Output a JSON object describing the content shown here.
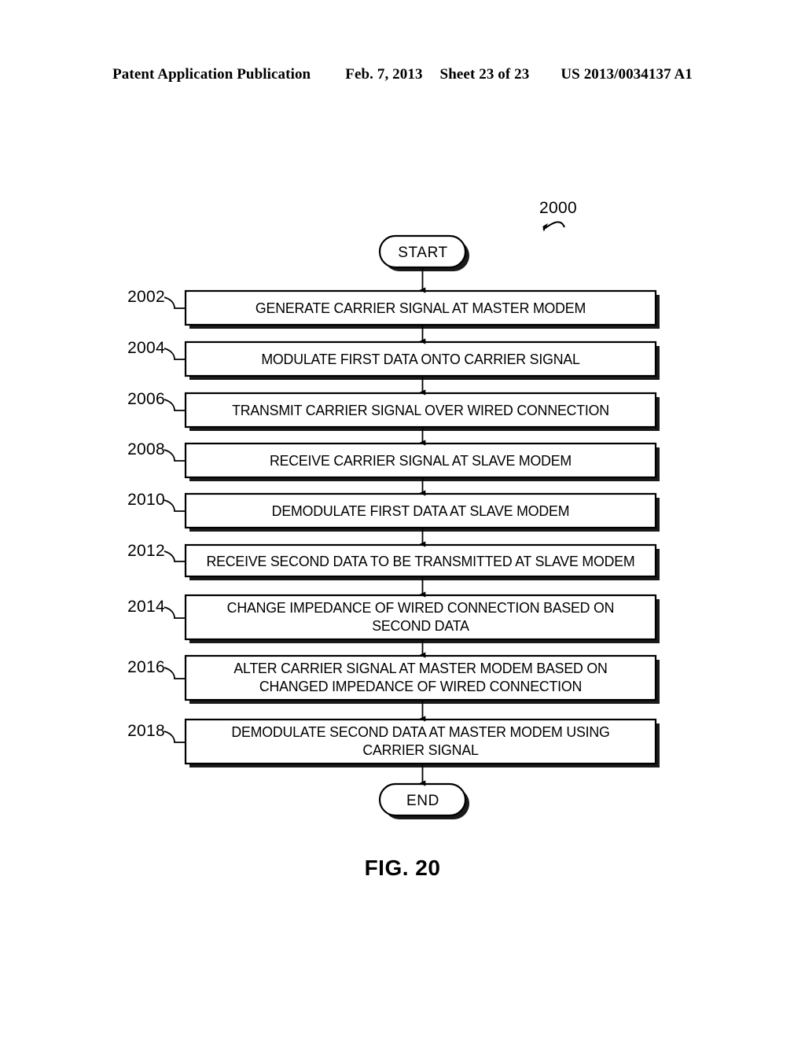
{
  "header": {
    "publication": "Patent Application Publication",
    "date": "Feb. 7, 2013",
    "sheet": "Sheet 23 of 23",
    "patent_number": "US 2013/0034137 A1"
  },
  "figure": {
    "caption": "FIG. 20",
    "callout": "2000",
    "start_label": "START",
    "end_label": "END",
    "steps": [
      {
        "ref": "2002",
        "text": "GENERATE CARRIER SIGNAL AT MASTER MODEM",
        "lines": 1
      },
      {
        "ref": "2004",
        "text": "MODULATE FIRST DATA ONTO CARRIER SIGNAL",
        "lines": 1
      },
      {
        "ref": "2006",
        "text": "TRANSMIT CARRIER SIGNAL OVER WIRED CONNECTION",
        "lines": 1
      },
      {
        "ref": "2008",
        "text": "RECEIVE CARRIER SIGNAL AT SLAVE MODEM",
        "lines": 1
      },
      {
        "ref": "2010",
        "text": "DEMODULATE FIRST DATA AT SLAVE MODEM",
        "lines": 1
      },
      {
        "ref": "2012",
        "text": "RECEIVE SECOND DATA TO BE TRANSMITTED AT SLAVE MODEM",
        "lines": 1
      },
      {
        "ref": "2014",
        "text": "CHANGE IMPEDANCE OF WIRED CONNECTION BASED ON\nSECOND DATA",
        "lines": 2
      },
      {
        "ref": "2016",
        "text": "ALTER CARRIER SIGNAL AT MASTER MODEM BASED ON\nCHANGED IMPEDANCE OF WIRED CONNECTION",
        "lines": 2
      },
      {
        "ref": "2018",
        "text": "DEMODULATE SECOND DATA AT MASTER MODEM USING\nCARRIER SIGNAL",
        "lines": 2
      }
    ]
  },
  "colors": {
    "ink": "#000000",
    "paper": "#ffffff",
    "shadow": "#1a1a1a"
  }
}
